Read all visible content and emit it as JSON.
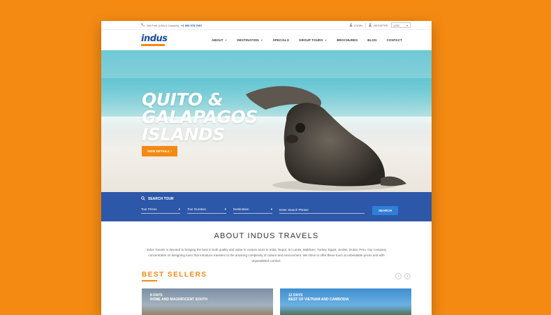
{
  "topbar": {
    "tollfree_label": "Toll Free (USA & Canada)",
    "phone": "+1 800 578 2997",
    "login": "LOGIN",
    "register": "REGISTER",
    "currency": "USD"
  },
  "brand": {
    "logo": "indus"
  },
  "nav": {
    "items": [
      {
        "label": "ABOUT",
        "dropdown": true
      },
      {
        "label": "DESTINATION",
        "dropdown": true
      },
      {
        "label": "SPECIALS",
        "dropdown": false
      },
      {
        "label": "GROUP TOURS",
        "dropdown": true
      },
      {
        "label": "BROCHURES",
        "dropdown": false
      },
      {
        "label": "BLOG",
        "dropdown": false
      },
      {
        "label": "CONTACT",
        "dropdown": false
      }
    ]
  },
  "hero": {
    "title_lines": [
      "QUITO &",
      "GALAPAGOS",
      "ISLANDS"
    ],
    "cta": "VIEW DETAILS"
  },
  "search": {
    "heading": "SEARCH TOUR",
    "tour_prices": "Tour Prices",
    "tour_duration": "Tour Duration",
    "destination": "Destination",
    "phrase_placeholder": "Enter Search Phrase",
    "button": "SEARCH"
  },
  "about": {
    "heading": "ABOUT INDUS TRAVELS",
    "text": "Indus Travels is devoted to bringing the best in both quality and value to custom tours to India, Nepal, Sri Lanka, Maldives, Turkey, Egypt, Jordan, Dubai, Peru. Our company concentrates on designing tours that introduce travelers to the amazing complexity of culture and environment. We strive to offer these tours at unbeatable prices and with unparalleled comfort."
  },
  "bestsellers": {
    "heading": "BEST SELLERS",
    "cards": [
      {
        "days": "8 DAYS",
        "name": "ROME AND MAGNIFICENT SOUTH"
      },
      {
        "days": "12 DAYS",
        "name": "BEST OF VIETNAM AND CAMBODIA"
      }
    ]
  },
  "colors": {
    "accent": "#f48a12",
    "brand_blue": "#1b4fa0",
    "search_bar": "#2d57a8"
  }
}
